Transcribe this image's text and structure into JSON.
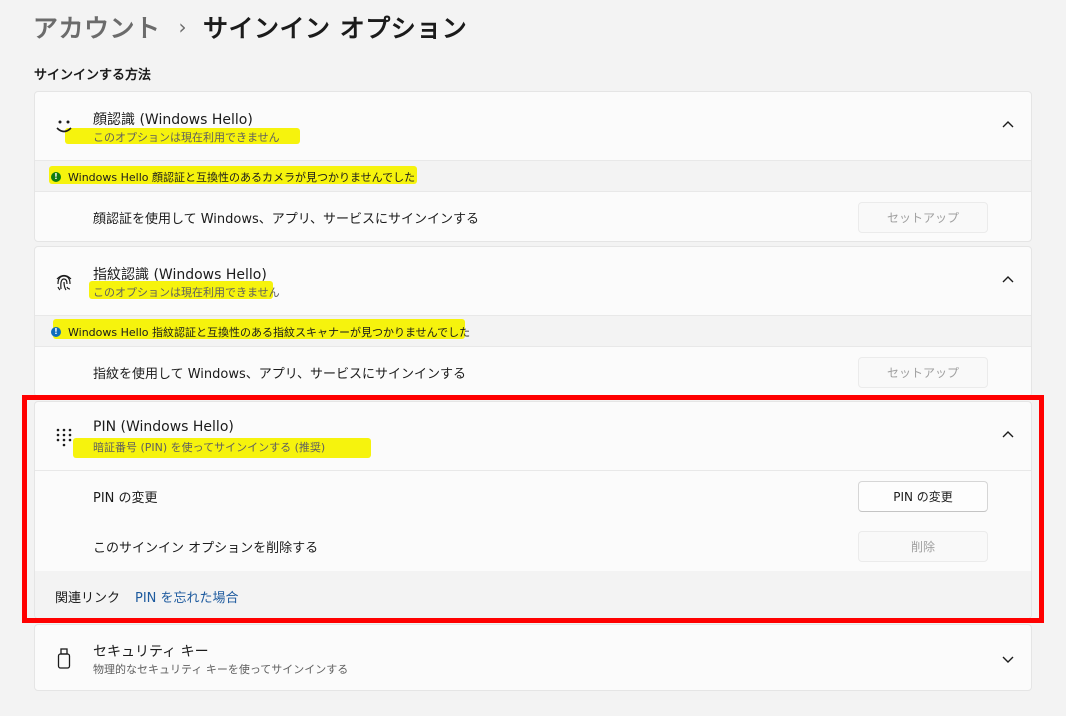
{
  "breadcrumb": {
    "parent": "アカウント",
    "separator": "›",
    "current": "サインイン オプション"
  },
  "section_title": "サインインする方法",
  "face": {
    "icon": "smiley-face-icon",
    "title": "顔認識 (Windows Hello)",
    "subtitle": "このオプションは現在利用できません",
    "notice_icon": "info-dot-icon",
    "notice": "Windows Hello 顔認証と互換性のあるカメラが見つかりませんでした",
    "row_label": "顔認証を使用して Windows、アプリ、サービスにサインインする",
    "button": "セットアップ"
  },
  "fingerprint": {
    "icon": "fingerprint-icon",
    "title": "指紋認識 (Windows Hello)",
    "subtitle": "このオプションは現在利用できません",
    "notice_icon": "info-dot-icon",
    "notice": "Windows Hello 指紋認証と互換性のある指紋スキャナーが見つかりませんでした",
    "row_label": "指紋を使用して Windows、アプリ、サービスにサインインする",
    "button": "セットアップ"
  },
  "pin": {
    "icon": "pin-keypad-icon",
    "title": "PIN (Windows Hello)",
    "subtitle": "暗証番号 (PIN) を使ってサインインする (推奨)",
    "change_label": "PIN の変更",
    "change_button": "PIN の変更",
    "remove_label": "このサインイン オプションを削除する",
    "remove_button": "削除",
    "related_label": "関連リンク",
    "forgot_link": "PIN を忘れた場合"
  },
  "security_key": {
    "icon": "usb-key-icon",
    "title": "セキュリティ キー",
    "subtitle": "物理的なセキュリティ キーを使ってサインインする"
  },
  "colors": {
    "highlight": "#f5f200",
    "annotation_frame": "#ff0000",
    "link": "#1d5a9e",
    "notice_dot": "#107c10"
  }
}
